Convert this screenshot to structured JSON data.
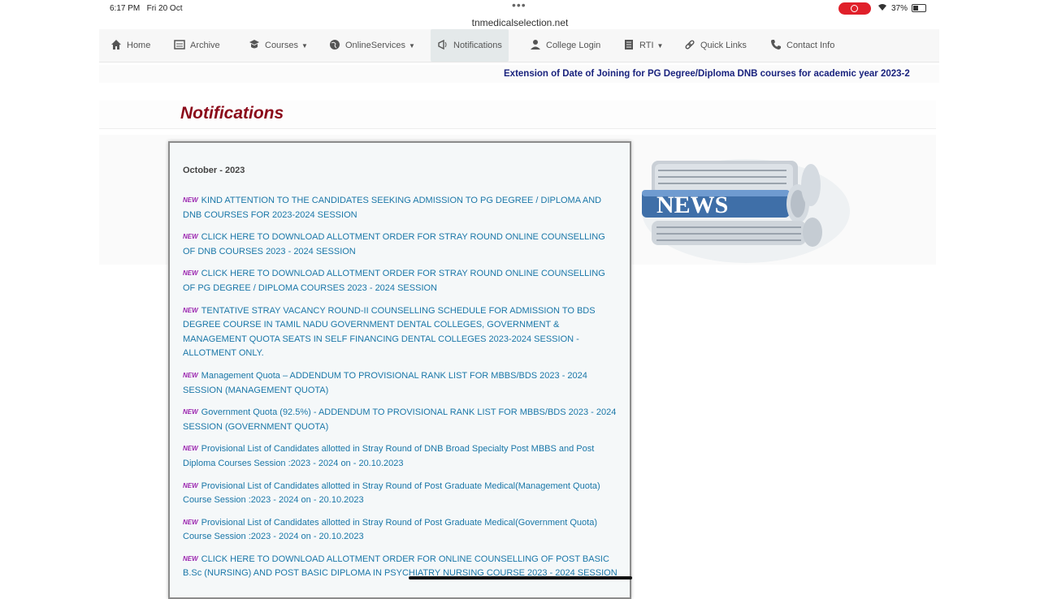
{
  "status": {
    "time": "6:17 PM",
    "date": "Fri 20 Oct",
    "url": "tnmedicalselection.net",
    "battery": "37%"
  },
  "nav": {
    "items": [
      {
        "label": "Home",
        "icon": "home-icon"
      },
      {
        "label": "Archive",
        "icon": "archive-icon"
      },
      {
        "label": "Courses",
        "icon": "courses-icon",
        "dropdown": true
      },
      {
        "label": "OnlineServices",
        "icon": "globe-icon",
        "dropdown": true
      },
      {
        "label": "Notifications",
        "icon": "notification-icon",
        "active": true
      },
      {
        "label": "College Login",
        "icon": "user-icon"
      },
      {
        "label": "RTI",
        "icon": "document-icon",
        "dropdown": true
      },
      {
        "label": "Quick Links",
        "icon": "link-icon"
      },
      {
        "label": "Contact Info",
        "icon": "phone-icon"
      }
    ]
  },
  "ticker": "Extension of Date of Joining for PG Degree/Diploma DNB courses for academic year 2023-2",
  "page_title": "Notifications",
  "panel": {
    "month": "October - 2023",
    "new_badge": "NEW",
    "items": [
      "KIND ATTENTION TO THE CANDIDATES SEEKING ADMISSION TO PG DEGREE / DIPLOMA AND DNB COURSES FOR 2023-2024 SESSION",
      "CLICK HERE TO DOWNLOAD ALLOTMENT ORDER FOR STRAY ROUND ONLINE COUNSELLING OF DNB COURSES 2023 - 2024 SESSION",
      "CLICK HERE TO DOWNLOAD ALLOTMENT ORDER FOR STRAY ROUND ONLINE COUNSELLING OF PG DEGREE / DIPLOMA COURSES 2023 - 2024 SESSION",
      "TENTATIVE STRAY VACANCY ROUND-II COUNSELLING SCHEDULE FOR ADMISSION TO BDS DEGREE COURSE IN TAMIL NADU GOVERNMENT DENTAL COLLEGES, GOVERNMENT & MANAGEMENT QUOTA SEATS IN SELF FINANCING DENTAL COLLEGES 2023-2024 SESSION - ALLOTMENT ONLY.",
      "Management Quota – ADDENDUM TO PROVISIONAL RANK LIST FOR MBBS/BDS 2023 - 2024 SESSION (MANAGEMENT QUOTA)",
      "Government Quota (92.5%) - ADDENDUM TO PROVISIONAL RANK LIST FOR MBBS/BDS 2023 - 2024 SESSION (GOVERNMENT QUOTA)",
      "Provisional List of Candidates allotted in Stray Round of DNB Broad Specialty Post MBBS and Post Diploma Courses Session :2023 - 2024 on - 20.10.2023",
      "Provisional List of Candidates allotted in Stray Round of Post Graduate Medical(Management Quota) Course Session :2023 - 2024 on - 20.10.2023",
      "Provisional List of Candidates allotted in Stray Round of Post Graduate Medical(Government Quota) Course Session :2023 - 2024 on - 20.10.2023",
      "CLICK HERE TO DOWNLOAD ALLOTMENT ORDER FOR ONLINE COUNSELLING OF POST BASIC B.Sc (NURSING) AND POST BASIC DIPLOMA IN PSYCHIATRY NURSING COURSE 2023 - 2024 SESSION"
    ]
  },
  "news_image_text": "NEWS",
  "colors": {
    "title": "#8b0a1a",
    "ticker": "#1a237e",
    "link": "#1a77a8",
    "badge": "#9c27b0"
  }
}
